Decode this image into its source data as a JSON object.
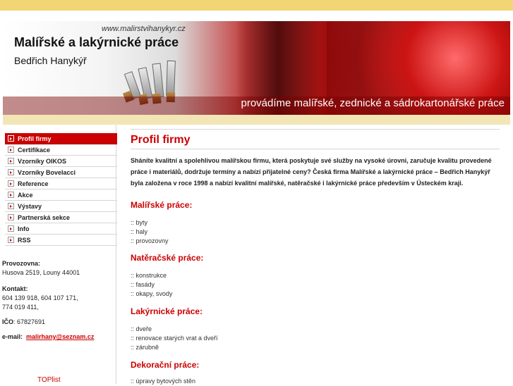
{
  "banner": {
    "url": "www.malirstvihanykyr.cz",
    "title": "Malířské a lakýrnické práce",
    "subtitle": "Bedřich Hanykýř",
    "slogan": "provádíme malířské, zednické a sádrokartonářské práce"
  },
  "menu": {
    "items": [
      {
        "label": "Profil firmy",
        "active": true
      },
      {
        "label": "Certifikace"
      },
      {
        "label": "Vzorníky OIKOS"
      },
      {
        "label": "Vzorníky Bovelacci"
      },
      {
        "label": "Reference"
      },
      {
        "label": "Akce"
      },
      {
        "label": "Výstavy"
      },
      {
        "label": "Partnerská sekce"
      },
      {
        "label": "Info"
      },
      {
        "label": "RSS"
      }
    ]
  },
  "contact": {
    "provozovna_label": "Provozovna:",
    "provozovna_value": "Husova 2519, Louny 44001",
    "kontakt_label": "Kontakt:",
    "kontakt_line1": "604 139 918, 604 107 171,",
    "kontakt_line2": "774 019 411,",
    "ico_label": "IČO",
    "ico_value": ": 67827691",
    "email_label": "e-mail:",
    "email_value": "malirhany@seznam.cz"
  },
  "toplist": "TOPlist",
  "main": {
    "title": "Profil firmy",
    "intro": "Sháníte kvalitní a spolehlivou malířskou firmu, která poskytuje své služby na vysoké úrovni, zaručuje kvalitu provedené práce i materiálů, dodržuje termíny a nabízí přijatelné ceny? Česká firma Malířské a lakýrnické práce – Bedřich Hanykýř byla založena v roce 1998 a nabízí kvalitní malířské, natěračské i lakýrnické práce především v Ústeckém kraji.",
    "sections": [
      {
        "heading": "Malířské práce:",
        "items": [
          ":: byty",
          ":: haly",
          ":: provozovny"
        ]
      },
      {
        "heading": "Natěračské práce:",
        "items": [
          ":: konstrukce",
          ":: fasády",
          ":: okapy, svody"
        ]
      },
      {
        "heading": "Lakýrnické práce:",
        "items": [
          ":: dveře",
          ":: renovace starých vrat a dveří",
          ":: zárubně"
        ]
      },
      {
        "heading": "Dekorační práce:",
        "items": [
          ":: úpravy bytových stěn"
        ]
      }
    ]
  },
  "colors": {
    "accent": "#cc0000",
    "topbar": "#f2d675"
  }
}
